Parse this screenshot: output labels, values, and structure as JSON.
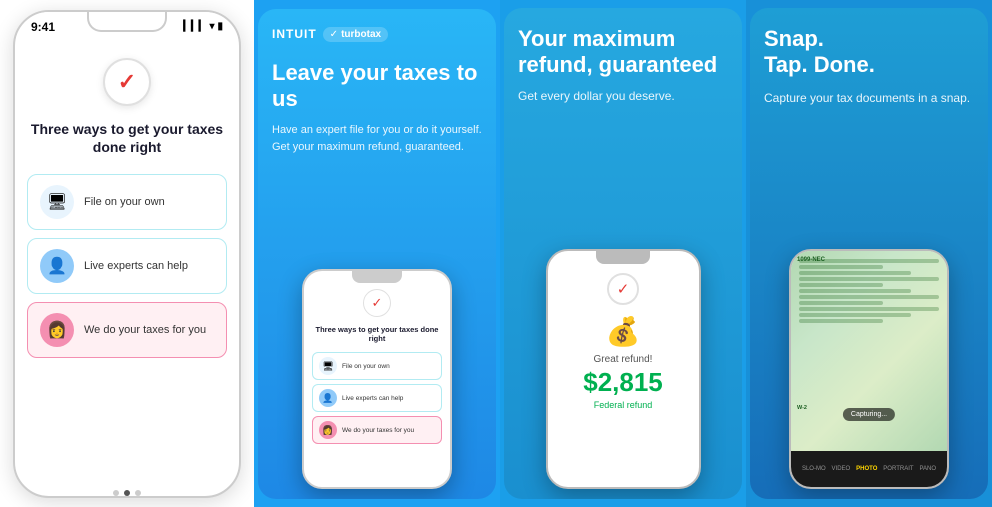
{
  "panel1": {
    "status_time": "9:41",
    "title": "Three ways to get your taxes done right",
    "options": [
      {
        "label": "File on your own",
        "icon": "🖥",
        "border": "blue",
        "icon_bg": "#e8f4fd"
      },
      {
        "label": "Live experts can help",
        "icon": "👤",
        "border": "blue",
        "icon_bg": "#90caf9"
      },
      {
        "label": "We do your taxes for you",
        "icon": "👩",
        "border": "pink",
        "icon_bg": "#f48fb1"
      }
    ]
  },
  "panel2": {
    "brand": "INTUIT",
    "product": "turbotax",
    "headline": "Leave your taxes to us",
    "subtext": "Have an expert file for you or do it yourself. Get your maximum refund, guaranteed.",
    "mini_title": "Three ways to get your taxes done right",
    "mini_options": [
      {
        "label": "File on your own",
        "type": "blue"
      },
      {
        "label": "Live experts can help",
        "type": "blue"
      },
      {
        "label": "We do your taxes for you",
        "type": "pink"
      }
    ]
  },
  "panel3": {
    "headline": "Your maximum refund, guaranteed",
    "subtext": "Get every dollar you deserve.",
    "refund_label": "Great refund!",
    "refund_amount": "$2,815",
    "refund_type": "Federal refund"
  },
  "panel4": {
    "headline": "Snap.\nTap. Done.",
    "subtext": "Capture your tax documents in a snap.",
    "doc_label": "1099-NEC",
    "w2_label": "W-2",
    "capturing_text": "Capturing...",
    "camera_modes": [
      "SLO-MO",
      "VIDEO",
      "PHOTO",
      "PORTRAIT",
      "PANO"
    ]
  }
}
